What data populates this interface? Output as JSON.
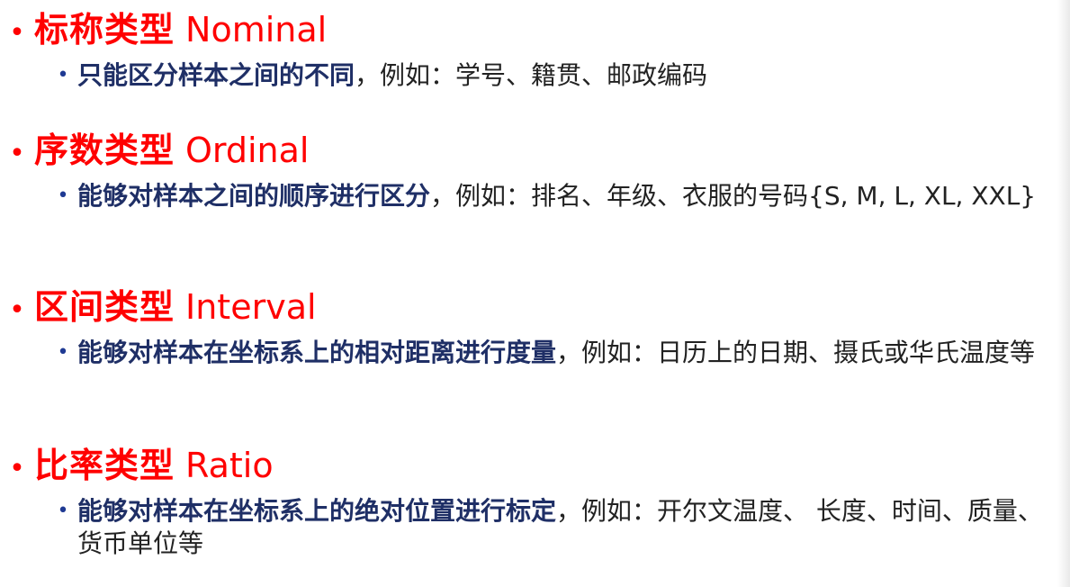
{
  "sections": [
    {
      "heading_zh": "标称类型",
      "heading_en": "Nominal",
      "desc_bold": "只能区分样本之间的不同",
      "desc_rest": "，例如：学号、籍贯、邮政编码"
    },
    {
      "heading_zh": "序数类型",
      "heading_en": "Ordinal",
      "desc_bold": "能够对样本之间的顺序进行区分",
      "desc_rest": "，例如：排名、年级、衣服的号码{S, M, L, XL, XXL}"
    },
    {
      "heading_zh": "区间类型",
      "heading_en": "Interval",
      "desc_bold": "能够对样本在坐标系上的相对距离进行度量",
      "desc_rest": "，例如：日历上的日期、摄氏或华氏温度等"
    },
    {
      "heading_zh": "比率类型",
      "heading_en": "Ratio",
      "desc_bold": "能够对样本在坐标系上的绝对位置进行标定",
      "desc_rest": "，例如：开尔文温度、 长度、时间、质量、货币单位等"
    }
  ],
  "colors": {
    "heading": "#ff0000",
    "bold_text": "#1f2f66",
    "body_text": "#222222"
  }
}
